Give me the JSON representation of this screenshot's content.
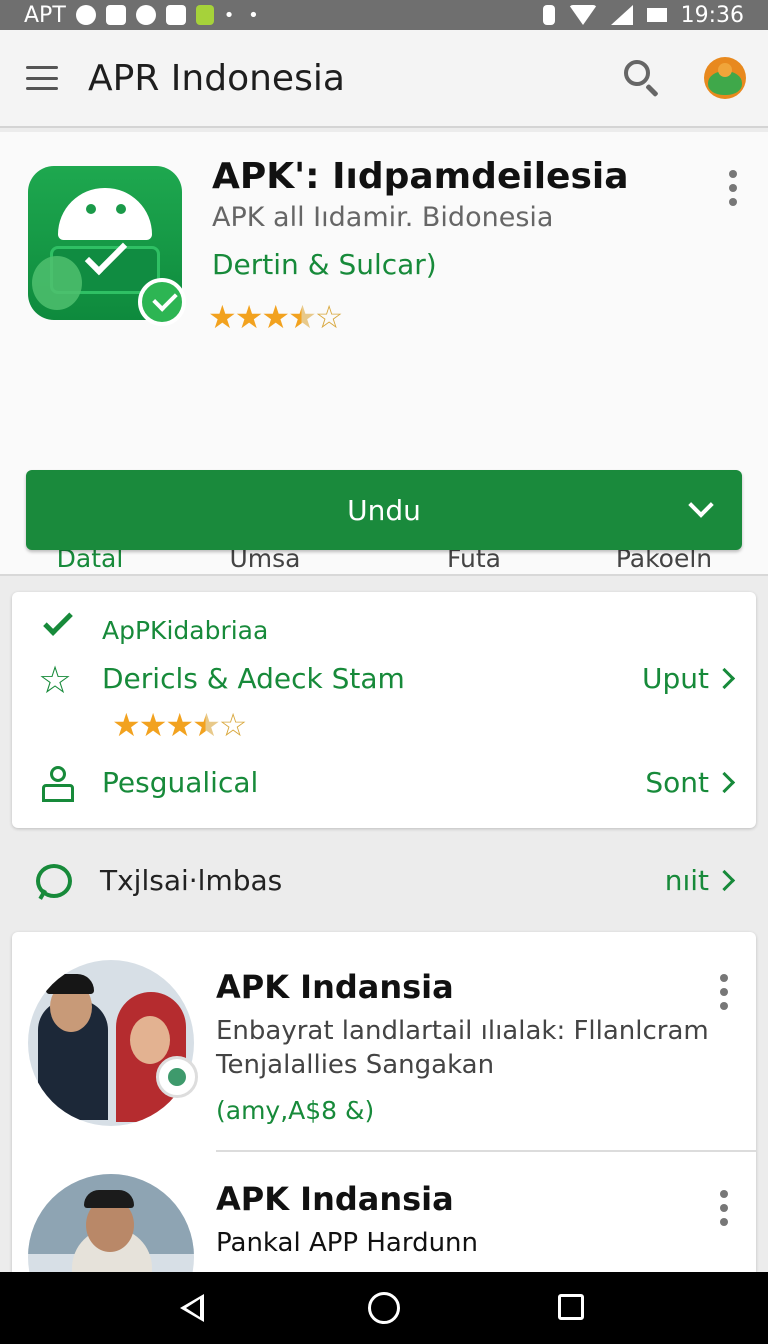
{
  "status_bar": {
    "carrier": "APT",
    "time": "19:36",
    "icons": [
      "sync-icon",
      "notification-icon",
      "heart-icon",
      "message-icon",
      "app-icon",
      "more-dots-icon",
      "bluetooth-icon",
      "wifi-icon",
      "signal-icon",
      "battery-icon"
    ]
  },
  "app_bar": {
    "title": "APR Indonesia",
    "icons": [
      "menu-icon",
      "search-icon",
      "profile-avatar-icon"
    ]
  },
  "app": {
    "title": "APK': Iıdpamdeilesia",
    "subtitle": "APK all Iıdamir. Bidonesia",
    "developer": "Dertin & Sulcar)",
    "rating_stars": 3.5,
    "rating_max": 5,
    "accent_color": "#178a3a"
  },
  "actions": [
    {
      "label": "Datal",
      "icon": "download-icon",
      "active": true
    },
    {
      "label": "Umsa",
      "icon": "media-icon",
      "active": false
    },
    {
      "label": "Futa",
      "icon": "clock-icon",
      "active": false
    },
    {
      "label": "Pakoeln",
      "icon": "camera-package-icon",
      "active": false
    }
  ],
  "install_button": {
    "label": "Undu",
    "color": "#1a8a3c"
  },
  "info": {
    "verified_label": "ApPKidabriaa",
    "reviews_label": "Dericls & Adeck Stam",
    "reviews_link": "Uput",
    "rating_stars": 3.5,
    "rating_max": 5,
    "permissions_label": "Pesgualical",
    "permissions_link": "Sont"
  },
  "reviews": {
    "title": "Txjlsai·lmbas",
    "link": "nıit",
    "items": [
      {
        "name": "APK Indansia",
        "line1": "Enbayrat landlartail ılıalak: Fllanlcram",
        "line2": "Tenjalallies Sangakan",
        "meta": "(amy,A$8 &)"
      },
      {
        "name": "APK Indansia",
        "line1": "Pankal APP Hardunn"
      }
    ]
  },
  "nav_bar": {
    "icons": [
      "back-icon",
      "home-icon",
      "recent-apps-icon"
    ]
  }
}
